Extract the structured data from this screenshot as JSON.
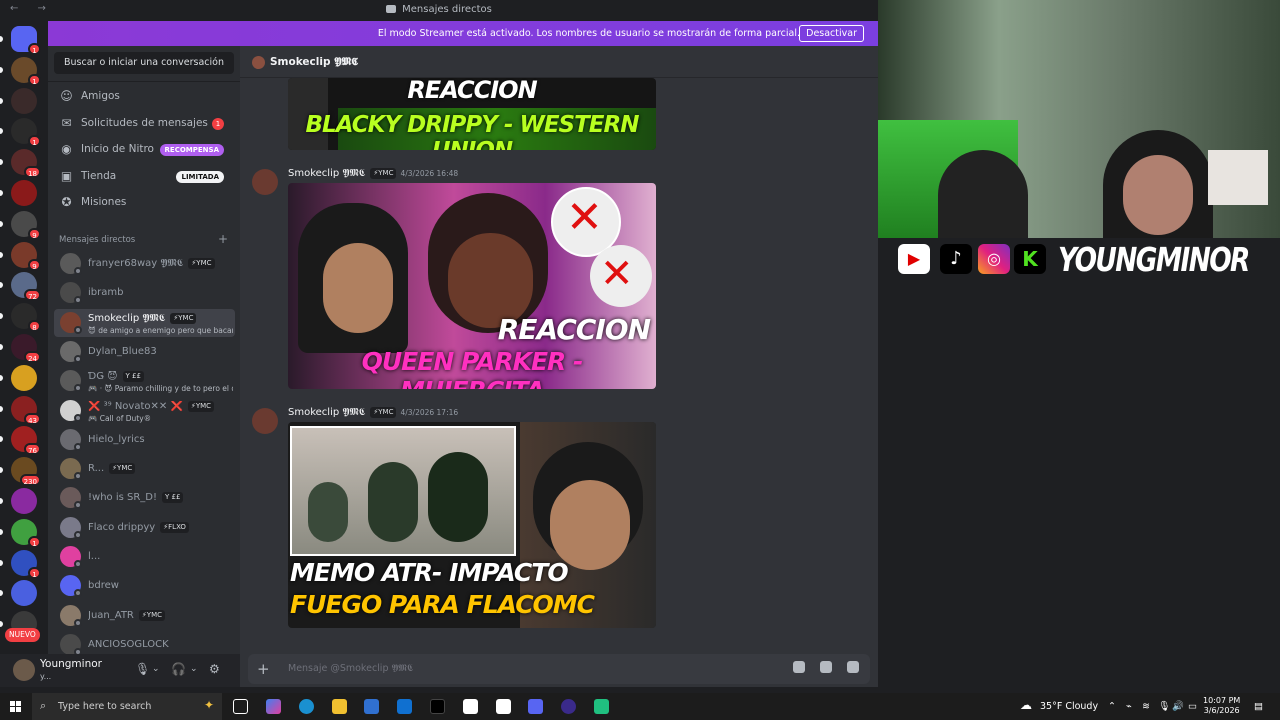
{
  "titlebar": {
    "nav": "← →",
    "title": "Mensajes directos"
  },
  "banner": {
    "message": "El modo Streamer está activado. Los nombres de usuario se mostrarán de forma parcial.",
    "button": "Desactivar"
  },
  "guilds": {
    "items": [
      {
        "name": "discord-home",
        "color": "#5865f2",
        "badge": "1"
      },
      {
        "name": "server-1",
        "color": "#6a4a2a",
        "badge": "1"
      },
      {
        "name": "server-2",
        "color": "#3a2a2a",
        "badge": ""
      },
      {
        "name": "server-3",
        "color": "#2a2a2a",
        "badge": "1"
      },
      {
        "name": "server-4",
        "color": "#5a2a2a",
        "badge": "18"
      },
      {
        "name": "server-5",
        "color": "#8a1a1a",
        "badge": ""
      },
      {
        "name": "server-6",
        "color": "#4a4a4a",
        "badge": "9"
      },
      {
        "name": "server-7",
        "color": "#7a3a2a",
        "badge": "9"
      },
      {
        "name": "server-8",
        "color": "#5a6a8a",
        "badge": "72"
      },
      {
        "name": "server-9",
        "color": "#2a2a2a",
        "badge": "8"
      },
      {
        "name": "server-10",
        "color": "#3a1a2a",
        "badge": "24"
      },
      {
        "name": "server-11",
        "color": "#d8a020",
        "badge": ""
      },
      {
        "name": "server-12",
        "color": "#8a2020",
        "badge": "43"
      },
      {
        "name": "server-13",
        "color": "#a02020",
        "badge": "76"
      },
      {
        "name": "server-14",
        "color": "#6a4a20",
        "badge": "230"
      },
      {
        "name": "server-15",
        "color": "#8a2aa0",
        "badge": ""
      },
      {
        "name": "server-16",
        "color": "#40a040",
        "badge": "1"
      },
      {
        "name": "server-17",
        "color": "#3050c0",
        "badge": "1"
      },
      {
        "name": "server-18",
        "color": "#4a60e0",
        "badge": ""
      },
      {
        "name": "server-19",
        "color": "#3a3a3a",
        "badge": "6"
      }
    ],
    "new_label": "NUEVO"
  },
  "sidebar": {
    "search": "Buscar o iniciar una conversación",
    "nav": [
      {
        "label": "Amigos",
        "icon": "friends-icon",
        "glyph": "☺"
      },
      {
        "label": "Solicitudes de mensajes",
        "icon": "mail-icon",
        "glyph": "✉",
        "count": "1"
      },
      {
        "label": "Inicio de Nitro",
        "icon": "nitro-icon",
        "glyph": "◉",
        "tag": "RECOMPENSA"
      },
      {
        "label": "Tienda",
        "icon": "shop-icon",
        "glyph": "▣",
        "tag": "LIMITADA"
      },
      {
        "label": "Misiones",
        "icon": "quests-icon",
        "glyph": "✪"
      }
    ],
    "dm_header": "Mensajes directos",
    "dm_add": "+",
    "dms": [
      {
        "name": "franyer68way 𝖄𝕸𝕮",
        "tag": "⚡YMC",
        "sub": "",
        "color": "#5a5a5a"
      },
      {
        "name": "ibramb",
        "tag": "",
        "sub": "",
        "color": "#4a4a4a"
      },
      {
        "name": "Smokeclip 𝖄𝕸𝕮",
        "tag": "⚡YMC",
        "sub": "😈 de amigo a enemigo pero que bacano...",
        "color": "#7a4030"
      },
      {
        "name": "Dylan_Blue83",
        "tag": "",
        "sub": "",
        "color": "#6a6a6a"
      },
      {
        "name": "ƊǤ 😈",
        "tag": "Y ££",
        "sub": "🎮 · 😈 Paramo chilling y de to pero el q...",
        "color": "#5a5a5a"
      },
      {
        "name": "❌ ³⁹ Novato✕✕ ❌",
        "tag": "⚡YMC",
        "sub": "🎮 Call of Duty®",
        "color": "#d0d0d0"
      },
      {
        "name": "Hielo_lyrics",
        "tag": "",
        "sub": "",
        "color": "#6a6a70"
      },
      {
        "name": "R...",
        "tag": "⚡YMC",
        "sub": "",
        "color": "#7a6a50"
      },
      {
        "name": "!who is SR_D!",
        "tag": "Y ££",
        "sub": "",
        "color": "#6a5a5a"
      },
      {
        "name": "Flaco drippyy",
        "tag": "⚡FLXO",
        "sub": "",
        "color": "#7a7a8a"
      },
      {
        "name": "l...",
        "tag": "",
        "sub": "",
        "color": "#e040a0"
      },
      {
        "name": "bdrew",
        "tag": "",
        "sub": "",
        "color": "#5865f2"
      },
      {
        "name": "Juan_ATR",
        "tag": "⚡YMC",
        "sub": "",
        "color": "#8a7a6a"
      },
      {
        "name": "ANCIOSOGLOCK",
        "tag": "",
        "sub": "",
        "color": "#4a4a4a"
      }
    ]
  },
  "user": {
    "name": "Youngminor",
    "status": "y..."
  },
  "chat": {
    "header": "Smokeclip 𝖄𝕸𝕮",
    "messages": [
      {
        "author": "",
        "tag": "",
        "time": "",
        "line1": "REACCION",
        "line2": "BLACKY DRIPPY - WESTERN UNION"
      },
      {
        "author": "Smokeclip 𝖄𝕸𝕮",
        "tag": "⚡YMC",
        "time": "4/3/2026 16:48",
        "line1": "REACCION",
        "line2": "QUEEN PARKER - MUJERCITA"
      },
      {
        "author": "Smokeclip 𝖄𝕸𝕮",
        "tag": "⚡YMC",
        "time": "4/3/2026 17:16",
        "line1": "MEMO ATR- IMPACTO",
        "line2": "FUEGO PARA FLACOMC"
      }
    ],
    "placeholder": "Mensaje @Smokeclip 𝖄𝕸𝕮"
  },
  "overlay": {
    "brand": "YOUNGMINOR"
  },
  "taskbar": {
    "search": "Type here to search",
    "weather": "35°F Cloudy",
    "time": "10:07 PM",
    "date": "3/6/2026"
  }
}
